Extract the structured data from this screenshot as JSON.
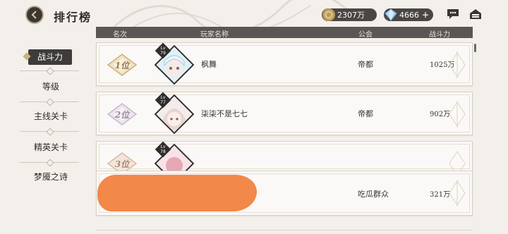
{
  "header": {
    "title": "排行榜",
    "gold": "2307万",
    "gems": "4666"
  },
  "sidebar": {
    "items": [
      {
        "label": "战斗力",
        "active": true
      },
      {
        "label": "等级",
        "active": false
      },
      {
        "label": "主线关卡",
        "active": false
      },
      {
        "label": "精英关卡",
        "active": false
      },
      {
        "label": "梦魇之诗",
        "active": false
      }
    ]
  },
  "table": {
    "columns": [
      "名次",
      "玩家名称",
      "公会",
      "战斗力"
    ],
    "rows": [
      {
        "rank": "1位",
        "level": "79",
        "name": "枫舞",
        "guild": "帝都",
        "power": "1025万"
      },
      {
        "rank": "2位",
        "level": "77",
        "name": "柒柒不是七七",
        "guild": "帝都",
        "power": "902万"
      },
      {
        "rank": "3位",
        "level": "78",
        "name": "",
        "guild": "",
        "power": ""
      },
      {
        "rank": "",
        "level": "",
        "name": "",
        "guild": "吃瓜群众",
        "power": "321万"
      }
    ]
  },
  "colors": {
    "accent_dark": "#3f3b3a",
    "gold": "#c9b37d",
    "mask": "#f2884a"
  }
}
